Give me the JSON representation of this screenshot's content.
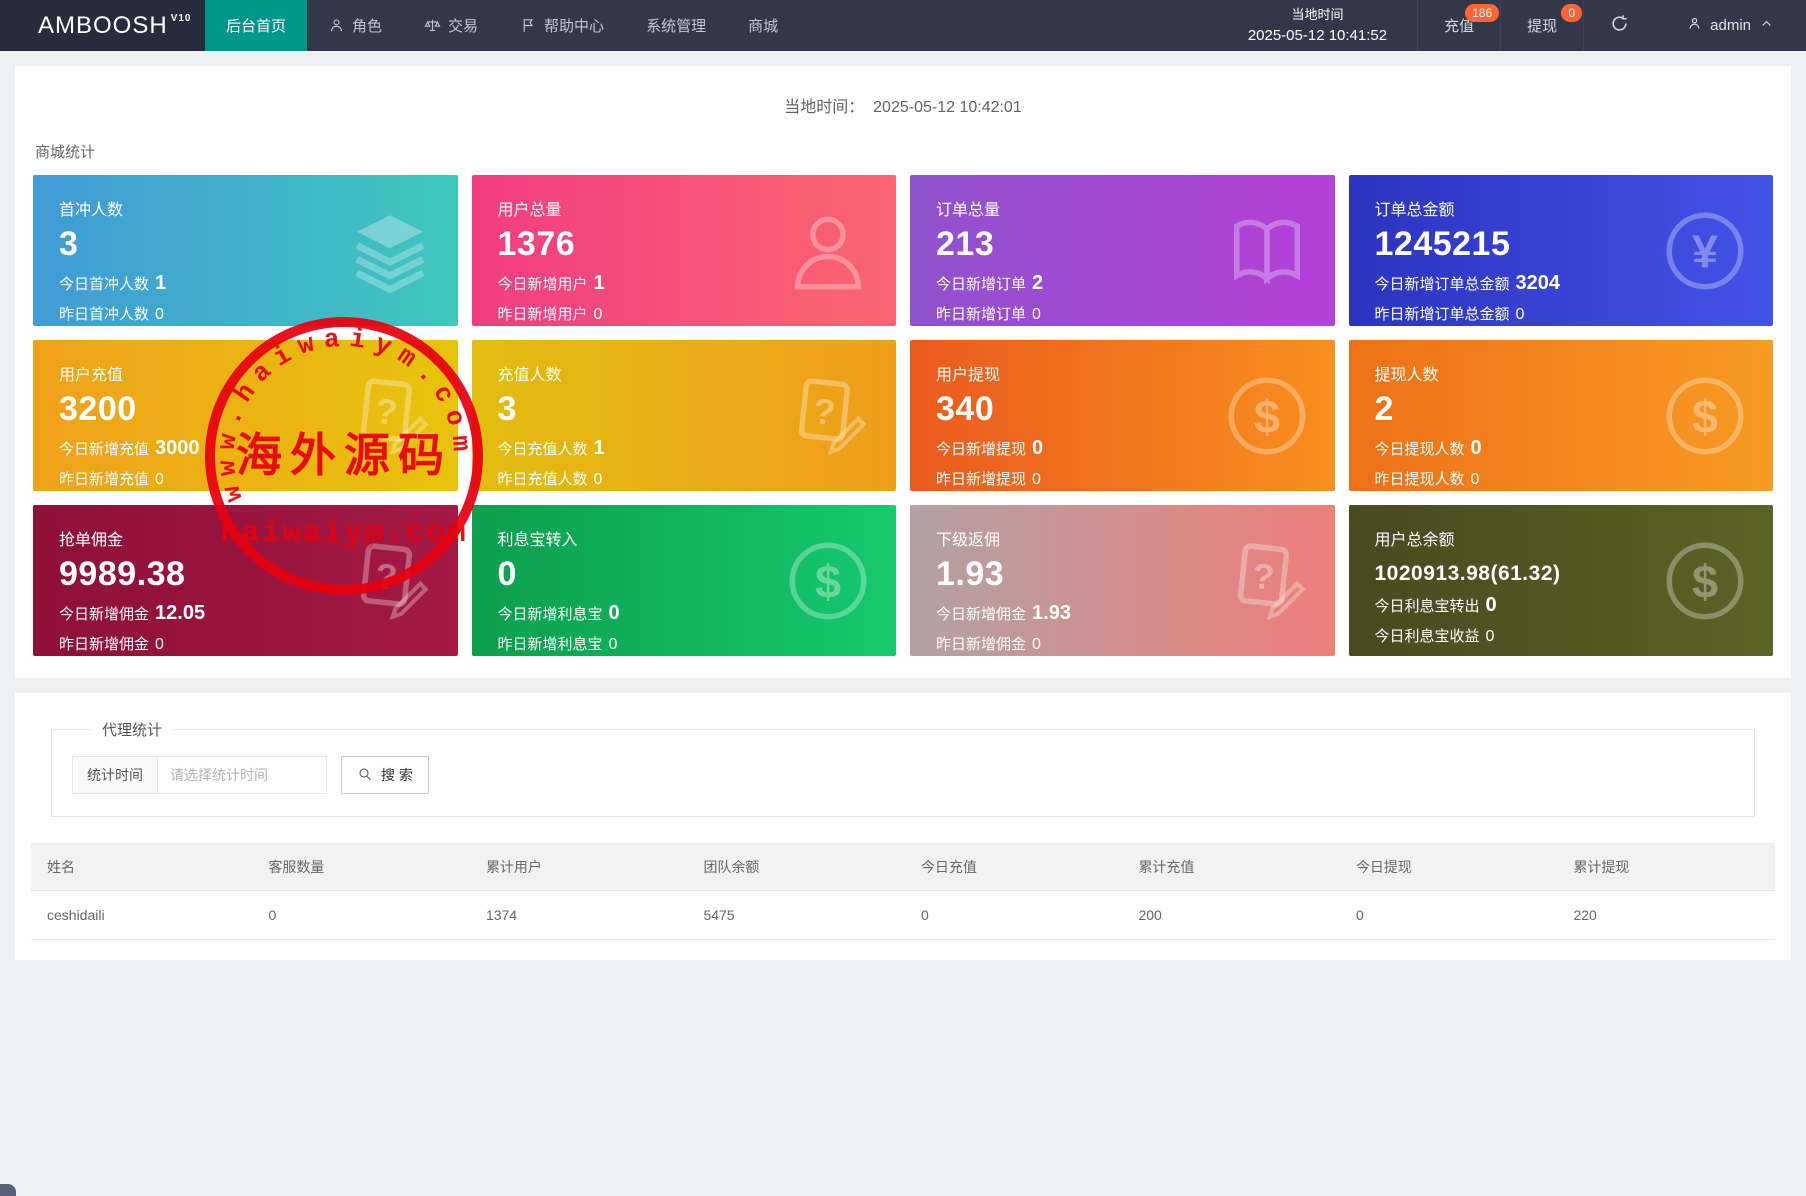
{
  "navbar": {
    "logo": "AMBOOSH",
    "logo_sup": "V10",
    "menu": [
      {
        "label": "后台首页",
        "icon": null,
        "active": true
      },
      {
        "label": "角色",
        "icon": "person",
        "active": false
      },
      {
        "label": "交易",
        "icon": "scales",
        "active": false
      },
      {
        "label": "帮助中心",
        "icon": "flag",
        "active": false
      },
      {
        "label": "系统管理",
        "icon": null,
        "active": false
      },
      {
        "label": "商城",
        "icon": null,
        "active": false
      }
    ],
    "local_time_label": "当地时间",
    "local_time_value": "2025-05-12 10:41:52",
    "recharge_label": "充值",
    "recharge_badge": "186",
    "withdraw_label": "提现",
    "withdraw_badge": "0",
    "user": "admin",
    "badge_color": "#ff6433",
    "active_color": "#009688"
  },
  "main": {
    "time_line_label": "当地时间：",
    "time_line_value": "2025-05-12 10:42:01",
    "section_title": "商城统计",
    "cards": [
      {
        "title": "首冲人数",
        "value": "3",
        "line1_label": "今日首冲人数",
        "line1_value": "1",
        "line2_label": "昨日首冲人数",
        "line2_value": "0",
        "icon": "layers",
        "gradient": [
          "#419bd6",
          "#3fc7bd"
        ]
      },
      {
        "title": "用户总量",
        "value": "1376",
        "line1_label": "今日新增用户",
        "line1_value": "1",
        "line2_label": "昨日新增用户",
        "line2_value": "0",
        "icon": "user",
        "gradient": [
          "#f23c82",
          "#f9676f"
        ]
      },
      {
        "title": "订单总量",
        "value": "213",
        "line1_label": "今日新增订单",
        "line1_value": "2",
        "line2_label": "昨日新增订单",
        "line2_value": "0",
        "icon": "book",
        "gradient": [
          "#8f52cc",
          "#b53fd9"
        ]
      },
      {
        "title": "订单总金额",
        "value": "1245215",
        "line1_label": "今日新增订单总金额",
        "line1_value": "3204",
        "line2_label": "昨日新增订单总金额",
        "line2_value": "0",
        "icon": "yen",
        "gradient": [
          "#2c34c0",
          "#4253e6"
        ]
      },
      {
        "title": "用户充值",
        "value": "3200",
        "line1_label": "今日新增充值",
        "line1_value": "3000",
        "line2_label": "昨日新增充值",
        "line2_value": "0",
        "icon": "doc",
        "gradient": [
          "#f0a11b",
          "#e7c40c"
        ]
      },
      {
        "title": "充值人数",
        "value": "3",
        "line1_label": "今日充值人数",
        "line1_value": "1",
        "line2_label": "昨日充值人数",
        "line2_value": "0",
        "icon": "doc",
        "gradient": [
          "#e2bd10",
          "#f09d1c"
        ]
      },
      {
        "title": "用户提现",
        "value": "340",
        "line1_label": "今日新增提现",
        "line1_value": "0",
        "line2_label": "昨日新增提现",
        "line2_value": "0",
        "icon": "dollar",
        "gradient": [
          "#ea5b1e",
          "#f88f1e"
        ]
      },
      {
        "title": "提现人数",
        "value": "2",
        "line1_label": "今日提现人数",
        "line1_value": "0",
        "line2_label": "昨日提现人数",
        "line2_value": "0",
        "icon": "dollar",
        "gradient": [
          "#ee7118",
          "#f89b24"
        ]
      },
      {
        "title": "抢单佣金",
        "value": "9989.38",
        "line1_label": "今日新增佣金",
        "line1_value": "12.05",
        "line2_label": "昨日新增佣金",
        "line2_value": "0",
        "icon": "doc",
        "gradient": [
          "#8d1039",
          "#a31a45"
        ]
      },
      {
        "title": "利息宝转入",
        "value": "0",
        "line1_label": "今日新增利息宝",
        "line1_value": "0",
        "line2_label": "昨日新增利息宝",
        "line2_value": "0",
        "icon": "dollar",
        "gradient": [
          "#0d9e4d",
          "#16c96e"
        ]
      },
      {
        "title": "下级返佣",
        "value": "1.93",
        "line1_label": "今日新增佣金",
        "line1_value": "1.93",
        "line2_label": "昨日新增佣金",
        "line2_value": "0",
        "icon": "doc",
        "gradient": [
          "#b3a2a4",
          "#ef7e79"
        ]
      },
      {
        "title": "用户总余额",
        "value": "1020913.98(61.32)",
        "small_value": true,
        "line1_label": "今日利息宝转出",
        "line1_value": "0",
        "line2_label": "今日利息宝收益",
        "line2_value": "0",
        "icon": "dollar",
        "gradient": [
          "#494a1e",
          "#5b6327"
        ]
      }
    ]
  },
  "agent": {
    "legend": "代理统计",
    "filter_label": "统计时间",
    "filter_placeholder": "请选择统计时间",
    "search_label": "搜 索",
    "table": {
      "headers": [
        "姓名",
        "客服数量",
        "累计用户",
        "团队余额",
        "今日充值",
        "累计充值",
        "今日提现",
        "累计提现"
      ],
      "rows": [
        [
          "ceshidaili",
          "0",
          "1374",
          "5475",
          "0",
          "200",
          "0",
          "220"
        ]
      ]
    }
  },
  "watermark": {
    "arc_text": "www.haiwaiym.com",
    "center_text": "海外源码",
    "sub_text": "haiwaiym.com",
    "bottom_arc_text": "haiwaiym.com",
    "color": "#e8000d"
  }
}
